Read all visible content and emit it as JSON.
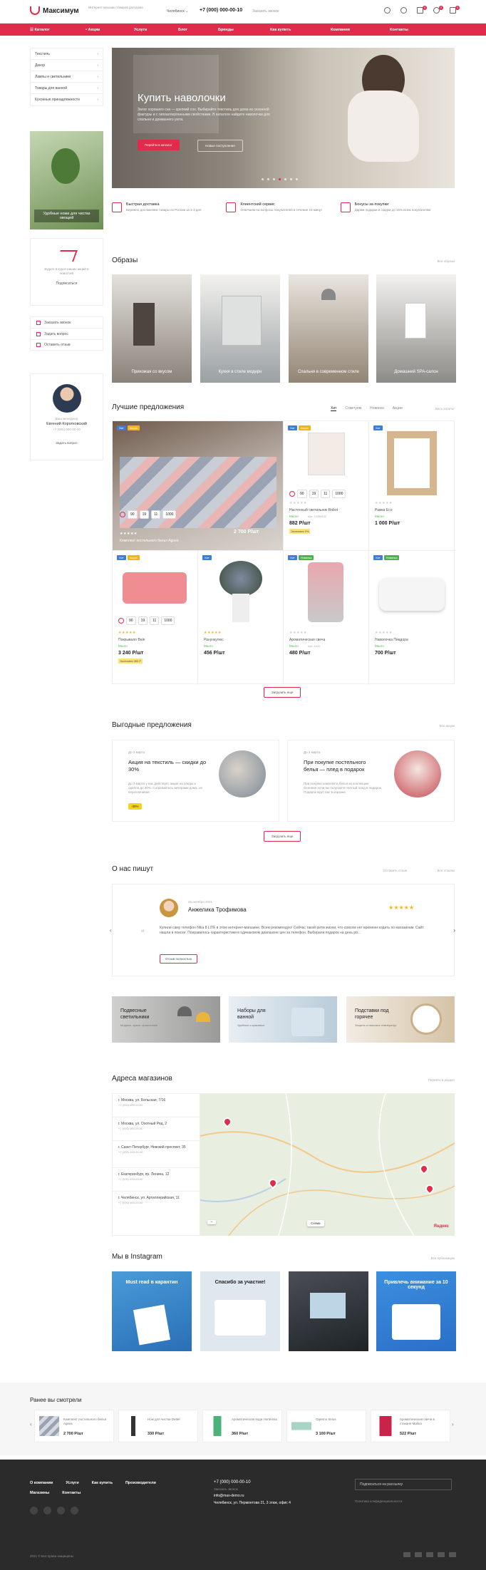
{
  "header": {
    "logo": "Максимум",
    "tagline": "Интернет-магазин товаров для дома",
    "city": "Челябинск",
    "phone": "+7 (000) 000-00-10",
    "callback": "Заказать звонок",
    "compare_count": "0",
    "fav_count": "0",
    "cart_count": "0"
  },
  "nav": [
    "Каталог",
    "Акции",
    "Услуги",
    "Блог",
    "Бренды",
    "Как купить",
    "Компания",
    "Контакты"
  ],
  "sidebar": {
    "menu": [
      "Текстиль",
      "Декор",
      "Лампы и светильники",
      "Товары для ванной",
      "Кухонные принадлежности"
    ],
    "promo": "Удобные ножи для чистки овощей",
    "subscribe_text": "Будьте в курсе наших акций и новостей",
    "subscribe_link": "Подписаться",
    "links": [
      "Заказать звонок",
      "Задать вопрос",
      "Оставить отзыв"
    ],
    "manager_role": "Ваш менеджер",
    "manager_name": "Евгений Коротковский",
    "manager_phone": "+7 (000) 000-00-00",
    "manager_ask": "Задать вопрос"
  },
  "hero": {
    "title": "Купить наволочки",
    "text": "Залог хорошего сна — крепкий сон. Выбирайте текстиль для дома из сезонной фактуры и с гипоаллергенными свойствами. В каталоге найдете наволочки для спальни и домашнего уюта.",
    "btn_primary": "Перейти в каталог",
    "btn_secondary": "Новые поступления"
  },
  "features": [
    {
      "title": "Быстрая доставка",
      "text": "Бережно доставляем товары по России за 1-3 дня"
    },
    {
      "title": "Клиентский сервис",
      "text": "Отвечаем на вопросы покупателей в течение 15 минут"
    },
    {
      "title": "Бонусы за покупки",
      "text": "Дарим подарки и скидки до 15% всем покупателям"
    }
  ],
  "looks": {
    "title": "Образы",
    "all": "Все образы",
    "items": [
      "Прихожая со вкусом",
      "Кухня в стиле модерн",
      "Спальня в современном стиле",
      "Домашний SPA-салон"
    ]
  },
  "best": {
    "title": "Лучшие предложения",
    "tabs": [
      "Хит",
      "Советуем",
      "Новинка",
      "Акции"
    ],
    "all": "Весь каталог",
    "more": "Загрузить еще",
    "timer": [
      "90",
      "19",
      "11",
      "1000"
    ],
    "products": [
      {
        "name": "Комплект постельного белья Agnes",
        "price": "2 700 Р/шт",
        "stock": "Много"
      },
      {
        "name": "Настенный светильник Robot",
        "price": "882 Р/шт",
        "stock": "Много",
        "art": "Арт. 14456122",
        "old": "Экономия 9%"
      },
      {
        "name": "Рамка Eco",
        "price": "1 000 Р/шт",
        "stock": "Много"
      },
      {
        "name": "Покрывало Bale",
        "price": "3 240 Р/шт",
        "stock": "Много",
        "old": "Экономия 360 Р"
      },
      {
        "name": "Ранункулюс",
        "price": "456 Р/шт",
        "stock": "Много"
      },
      {
        "name": "Ароматическая свеча",
        "price": "480 Р/шт",
        "stock": "Много",
        "art": "Арт. 4422"
      },
      {
        "name": "Наволочка Пиадора",
        "price": "700 Р/шт",
        "stock": "Много"
      }
    ]
  },
  "deals": {
    "title": "Выгодные предложения",
    "all": "Все акции",
    "more": "Загрузить еще",
    "items": [
      {
        "date": "До 3 марта",
        "title": "Акция на текстиль — скидки до 30%",
        "text": "До 3 марта у нас действует акция на пледы и одеяла до 30%. Согревайтесь вечерами дома, не переплачивая.",
        "tag": "-30%"
      },
      {
        "date": "До 3 марта",
        "title": "При покупке постельного белья — плед в подарок",
        "text": "При покупке комплекта белья из коллекции Осенние ночи вы получаете теплый плед в подарок. Подарок ждет вас в корзине."
      }
    ]
  },
  "reviews": {
    "title": "О нас пишут",
    "leave": "Оставить отзыв",
    "all": "Все отзывы",
    "date": "25 октября 2021",
    "name": "Анжелика Трофимова",
    "stars": "★★★★★",
    "text": "Купили саму телефон Nika 8 LITE в этом интернет-магазине. Всем рекомендую! Сейчас такой ритм жизни, что совсем нет времени ходить по магазинам. Сайт нашли в поиске. Понравилось характеристики в одинаковом диапазоне цен за телефон. Выбирали подарок на день ро...",
    "more": "Отзыв полностью"
  },
  "banners": [
    {
      "title": "Подвесные светильники",
      "sub": "Модные, яркие, практичные"
    },
    {
      "title": "Наборы для ванной",
      "sub": "Удобные и красивые"
    },
    {
      "title": "Подставки под горячее",
      "sub": "Защита от высоких температур"
    }
  ],
  "stores": {
    "title": "Адреса магазинов",
    "all": "Перейти в раздел",
    "items": [
      {
        "addr": "г. Москва, ул. Бельская, 7/16",
        "phone": "+7 (000) 000-00-00"
      },
      {
        "addr": "г. Москва, ул. Охотный Ряд, 2",
        "phone": "+7 (000) 000-00-00"
      },
      {
        "addr": "г. Санкт-Петербург, Невский проспект, 35",
        "phone": "+7 (000) 000-00-00"
      },
      {
        "addr": "г. Екатеринбург, пр. Ленина, 12",
        "phone": "+7 (000) 000-00-00"
      },
      {
        "addr": "г. Челябинск, ул. Артиллерийская, 11",
        "phone": "+7 (000) 000-00-00"
      }
    ],
    "map_mode": "Схема",
    "map_brand": "Яндекс"
  },
  "instagram": {
    "title": "Мы в Instagram",
    "all": "Все публикации",
    "posts": [
      "Must read в карантин",
      "Спасибо за участие!",
      "",
      "Привлечь внимание за 10 секунд"
    ]
  },
  "recent": {
    "title": "Ранее вы смотрели",
    "items": [
      {
        "name": "Комплект постельного белья Agnes",
        "price": "2 700 Р/шт"
      },
      {
        "name": "Нож для чистки Dettel",
        "price": "330 Р/шт"
      },
      {
        "name": "Ароматическая вода Hortensia",
        "price": "360 Р/шт"
      },
      {
        "name": "Одеяло Sirius",
        "price": "3 100 Р/шт"
      },
      {
        "name": "Ароматическая свеча в стакане Malina",
        "price": "522 Р/шт"
      }
    ]
  },
  "footer": {
    "nav1": [
      "О компании",
      "Услуги",
      "Как купить",
      "Производители"
    ],
    "nav2": [
      "Магазины",
      "Контакты"
    ],
    "phone": "+7 (000) 000-00-10",
    "callback": "Заказать звонок",
    "email": "info@max-demo.ru",
    "address": "Челябинск, ул. Пермонтова 21, 3 этаж, офис 4",
    "subscribe": "Подписаться на рассылку",
    "policy": "Политика конфиденциальности",
    "copyright": "2021 © Все права защищены"
  }
}
